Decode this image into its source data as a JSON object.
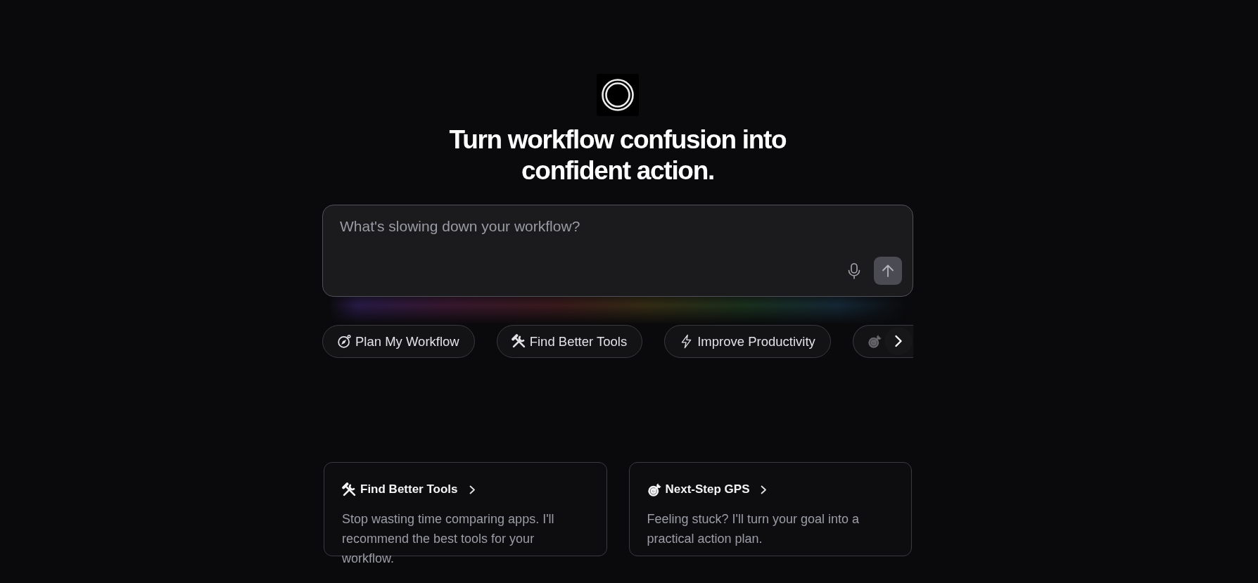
{
  "heading": "Turn workflow confusion into confident action.",
  "prompt": {
    "placeholder": "What's slowing down your workflow?"
  },
  "suggestions": [
    {
      "kind": "compass",
      "label": "Plan My Workflow"
    },
    {
      "kind": "tools",
      "label": "Find Better Tools"
    },
    {
      "kind": "bolt",
      "label": "Improve Productivity"
    },
    {
      "kind": "target"
    }
  ],
  "cards": [
    {
      "kind": "tools",
      "title": "Find Better Tools",
      "description": "Stop wasting time comparing apps. I'll recommend the best tools for your workflow."
    },
    {
      "kind": "target",
      "title": "Next-Step GPS",
      "description": "Feeling stuck? I'll turn your goal into a practical action plan."
    }
  ]
}
